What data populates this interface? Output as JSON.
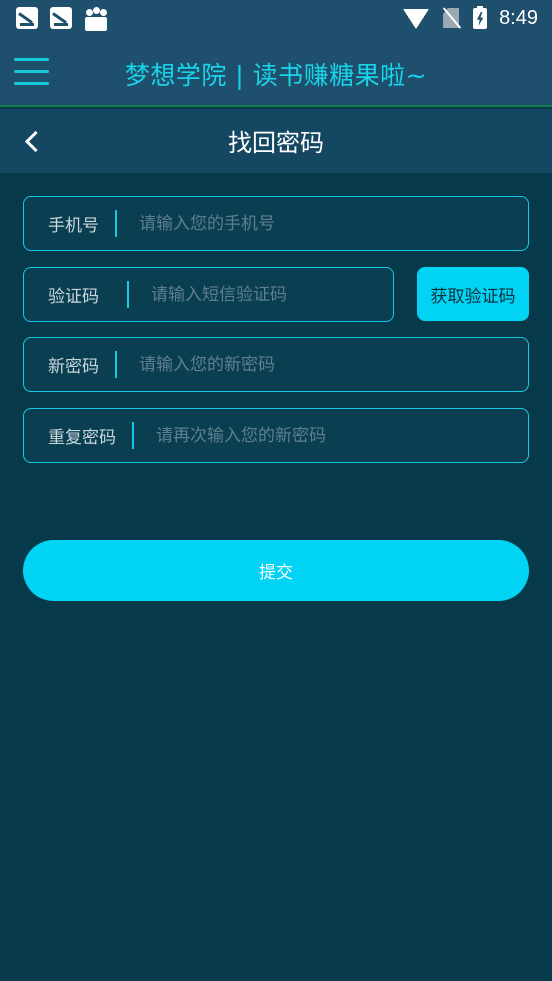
{
  "status_bar": {
    "time": "8:49",
    "icons": [
      "notification-icon",
      "notification-icon",
      "shopping-bag-icon",
      "wifi-icon",
      "no-sim-icon",
      "battery-charging-icon"
    ]
  },
  "header": {
    "title": "梦想学院 | 读书赚糖果啦~",
    "menu_icon": "menu-icon"
  },
  "page": {
    "title": "找回密码",
    "back_icon": "chevron-left-icon"
  },
  "form": {
    "phone": {
      "label": "手机号",
      "placeholder": "请输入您的手机号",
      "value": ""
    },
    "code": {
      "label": "验证码",
      "placeholder": "请输入短信验证码",
      "value": ""
    },
    "get_code_label": "获取验证码",
    "new_password": {
      "label": "新密码",
      "placeholder": "请输入您的新密码",
      "value": ""
    },
    "confirm_password": {
      "label": "重复密码",
      "placeholder": "请再次输入您的新密码",
      "value": ""
    },
    "submit_label": "提交"
  },
  "colors": {
    "background": "#06394a",
    "header": "#1e4f6c",
    "accent": "#00d3f4",
    "title_cyan": "#19d4e8"
  }
}
